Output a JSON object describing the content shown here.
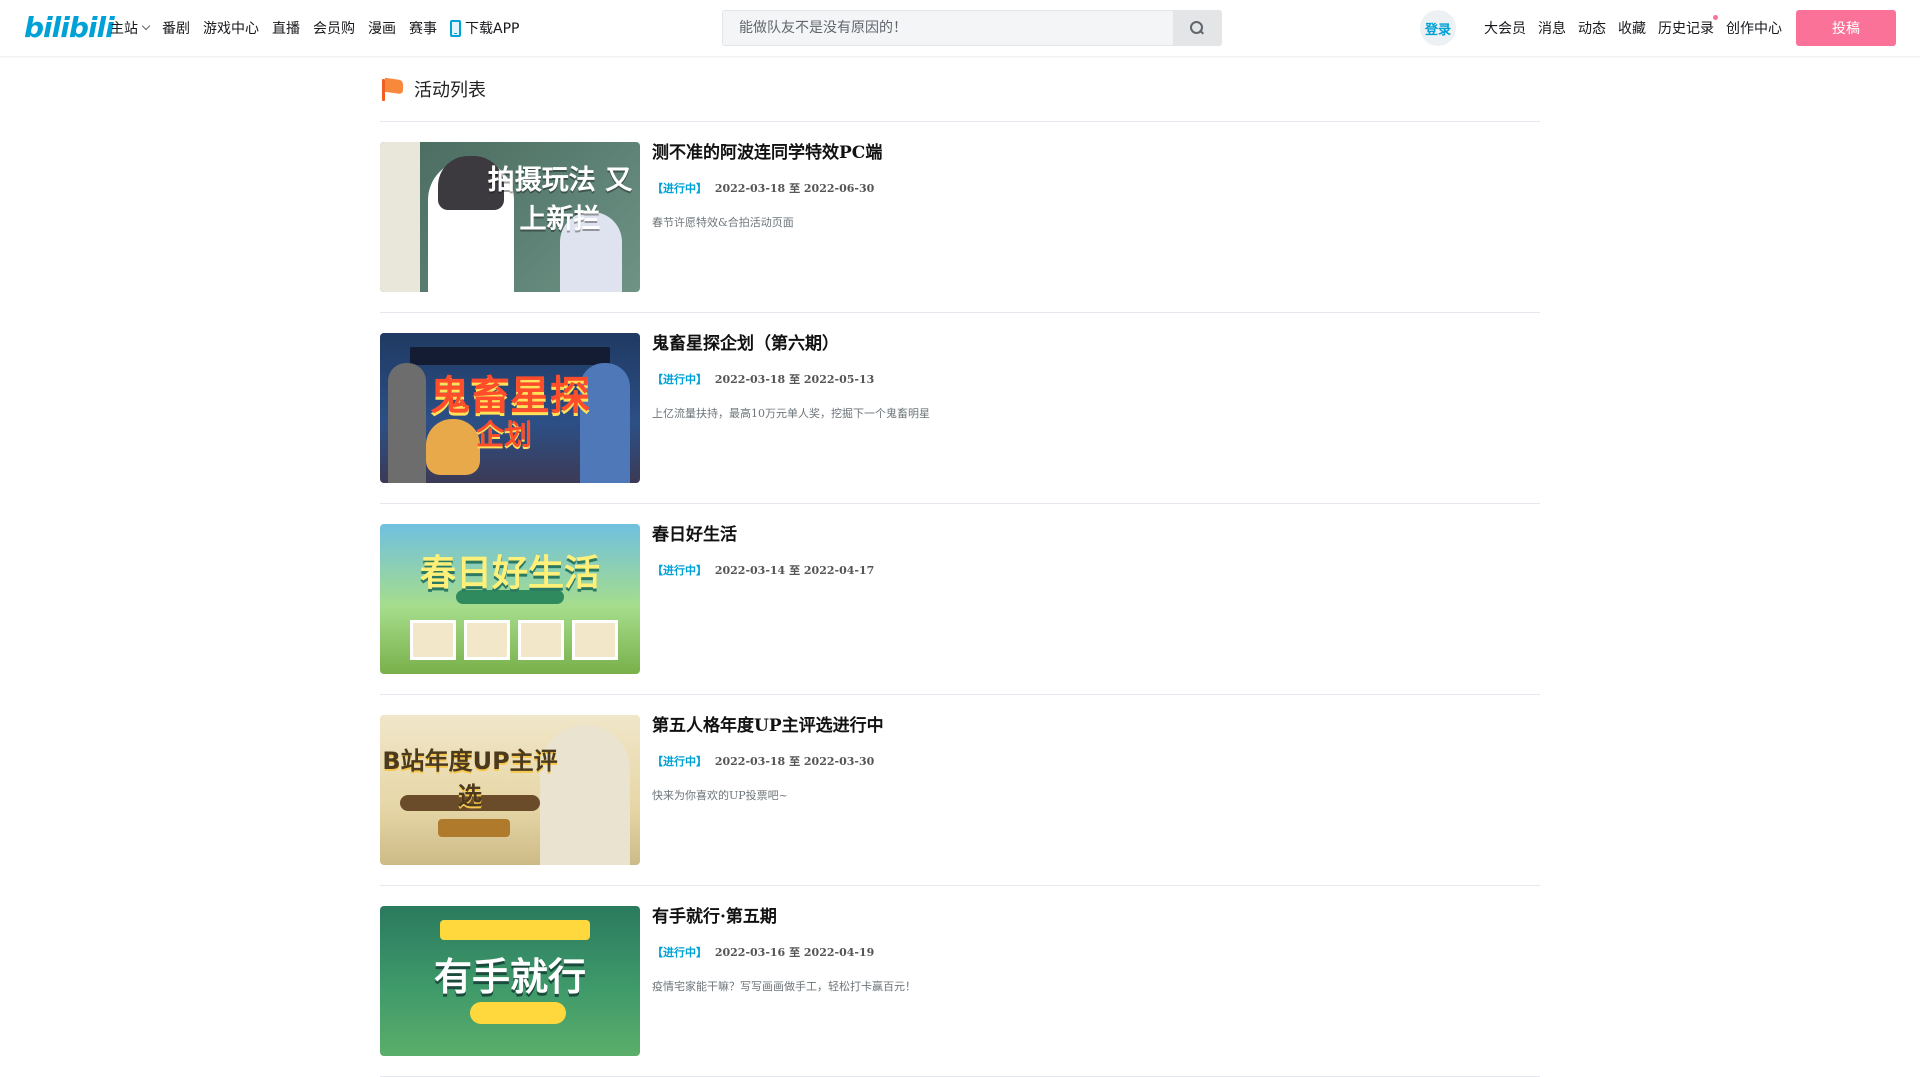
{
  "header": {
    "logo_text": "bilibili",
    "nav_left": [
      {
        "label": "主站",
        "has_dropdown": true
      },
      {
        "label": "番剧"
      },
      {
        "label": "游戏中心"
      },
      {
        "label": "直播"
      },
      {
        "label": "会员购"
      },
      {
        "label": "漫画"
      },
      {
        "label": "赛事"
      },
      {
        "label": "下载APP",
        "icon": "phone-icon"
      }
    ],
    "search": {
      "placeholder": "能做队友不是没有原因的！"
    },
    "login_label": "登录",
    "nav_right": [
      {
        "label": "大会员"
      },
      {
        "label": "消息"
      },
      {
        "label": "动态"
      },
      {
        "label": "收藏"
      },
      {
        "label": "历史记录",
        "has_dot": true
      },
      {
        "label": "创作中心"
      }
    ],
    "upload_label": "投稿"
  },
  "section": {
    "title": "活动列表",
    "icon": "flag-icon"
  },
  "activities": [
    {
      "title": "测不准的阿波连同学特效PC端",
      "status": "【进行中】",
      "date_start": "2022-03-18",
      "date_sep": "至",
      "date_end": "2022-06-30",
      "desc": "春节许愿特效&合拍活动页面",
      "thumb_text": "拍摄玩法 又上新拦"
    },
    {
      "title": "鬼畜星探企划（第六期）",
      "status": "【进行中】",
      "date_start": "2022-03-18",
      "date_sep": "至",
      "date_end": "2022-05-13",
      "desc": "上亿流量扶持，最高10万元单人奖，挖掘下一个鬼畜明星",
      "thumb_text": "鬼畜星探",
      "thumb_sub": "企划"
    },
    {
      "title": "春日好生活",
      "status": "【进行中】",
      "date_start": "2022-03-14",
      "date_sep": "至",
      "date_end": "2022-04-17",
      "desc": "",
      "thumb_text": "春日好生活"
    },
    {
      "title": "第五人格年度UP主评选进行中",
      "status": "【进行中】",
      "date_start": "2022-03-18",
      "date_sep": "至",
      "date_end": "2022-03-30",
      "desc": "快来为你喜欢的UP投票吧~",
      "thumb_text": "B站年度UP主评选"
    },
    {
      "title": "有手就行·第五期",
      "status": "【进行中】",
      "date_start": "2022-03-16",
      "date_sep": "至",
      "date_end": "2022-04-19",
      "desc": "疫情宅家能干嘛？写写画画做手工，轻松打卡赢百元！",
      "thumb_text": "有手就行"
    }
  ]
}
